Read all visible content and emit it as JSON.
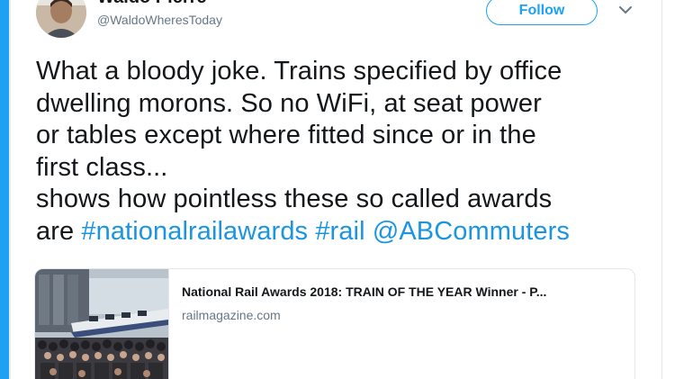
{
  "tweet": {
    "author": {
      "display_name": "Waldo Pierre",
      "handle": "@WaldoWheresToday",
      "avatar_icon": "user-avatar-photo"
    },
    "follow_label": "Follow",
    "caret_icon": "chevron-down-icon",
    "text_lines": [
      [
        {
          "t": "What a bloody joke. Trains specified by office"
        }
      ],
      [
        {
          "t": "dwelling morons. So no WiFi, at seat power"
        }
      ],
      [
        {
          "t": "or tables except where fitted since or in the"
        }
      ],
      [
        {
          "t": "first class..."
        }
      ],
      [
        {
          "t": "shows how pointless these so called awards"
        }
      ],
      [
        {
          "t": "are "
        },
        {
          "t": "#nationalrailawards",
          "link": true
        },
        {
          "t": " "
        },
        {
          "t": "#rail",
          "link": true
        },
        {
          "t": " "
        },
        {
          "t": "@ABCommuters",
          "link": true
        }
      ]
    ],
    "card": {
      "title": "National Rail Awards 2018: TRAIN OF THE YEAR Winner - P...",
      "domain": "railmagazine.com"
    }
  },
  "colors": {
    "accent": "#1da1f2",
    "link": "#1b95e0",
    "text": "#14171a",
    "muted": "#657786"
  }
}
